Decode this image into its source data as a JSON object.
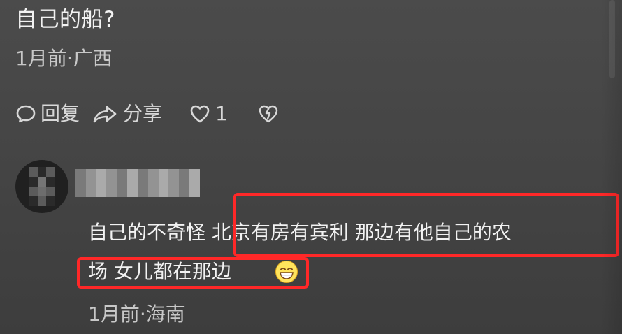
{
  "post": {
    "text": "自己的船?",
    "meta": "1月前·广西"
  },
  "actions": {
    "reply": "回复",
    "share": "分享",
    "like_count": "1"
  },
  "comment": {
    "line1": "自己的不奇怪  北京有房有宾利  那边有他自己的农",
    "line2": "场  女儿都在那边",
    "meta": "1月前·海南",
    "emoji": "grinning-face-icon"
  },
  "icons": {
    "reply": "comment-icon",
    "share": "share-icon",
    "like": "heart-icon",
    "dislike": "broken-heart-icon"
  },
  "colors": {
    "highlight": "#ff2828",
    "text": "#f2f2f2",
    "meta": "#c8c8c8"
  }
}
